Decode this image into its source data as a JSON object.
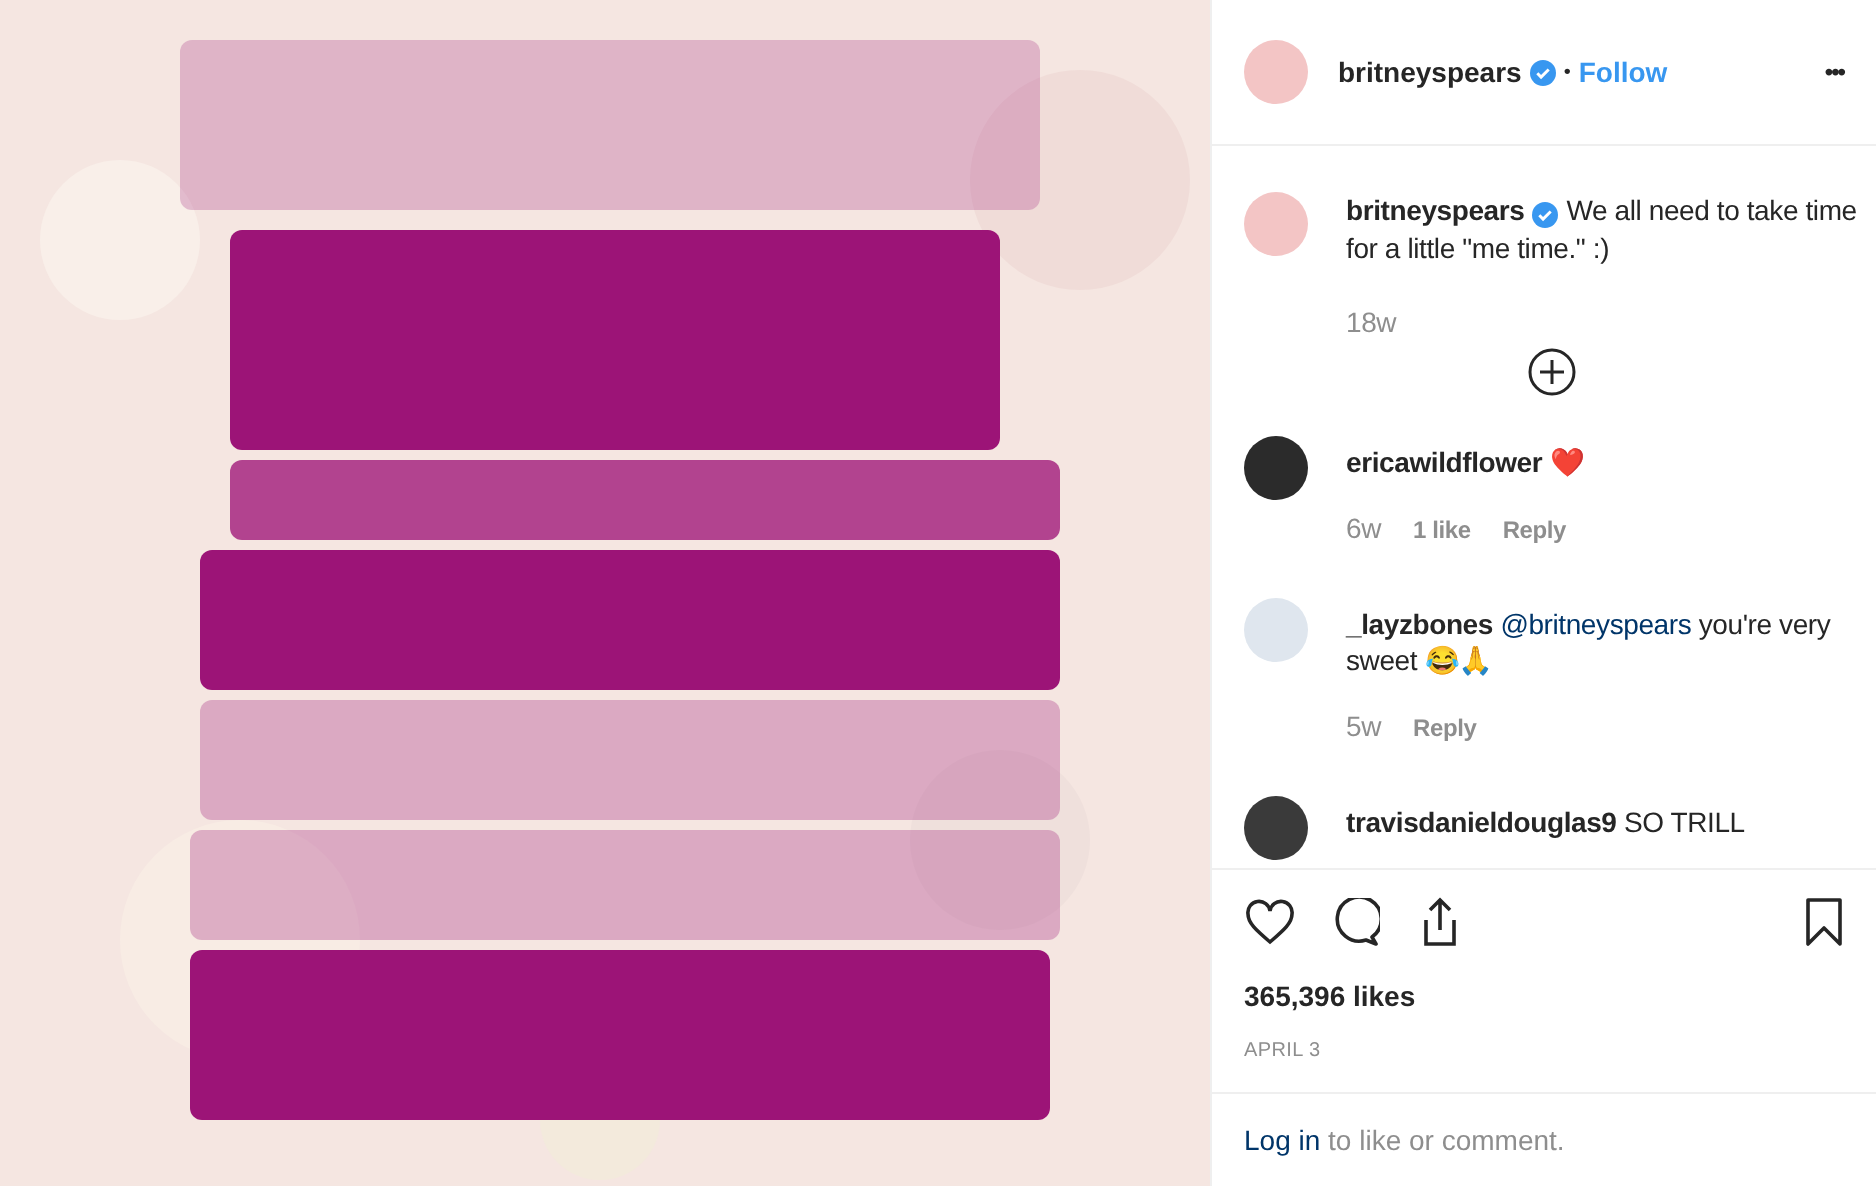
{
  "header": {
    "username": "britneyspears",
    "verified": true,
    "separator": "•",
    "follow": "Follow",
    "more": "•••"
  },
  "caption": {
    "username": "britneyspears",
    "verified": true,
    "text": "We all need to take time for a little \"me time.\" :)",
    "time": "18w"
  },
  "comments": [
    {
      "username": "ericawildflower",
      "text": "❤️",
      "time": "6w",
      "likes": "1 like",
      "reply": "Reply"
    },
    {
      "username": "_layzbones",
      "mention": "@britneyspears",
      "text": "you're very sweet 😂🙏",
      "time": "5w",
      "reply": "Reply"
    },
    {
      "username": "travisdanieldouglas9",
      "text": "SO TRILL"
    }
  ],
  "likes": "365,396 likes",
  "date": "APRIL 3",
  "login": {
    "link": "Log in",
    "text": "to like or comment."
  }
}
